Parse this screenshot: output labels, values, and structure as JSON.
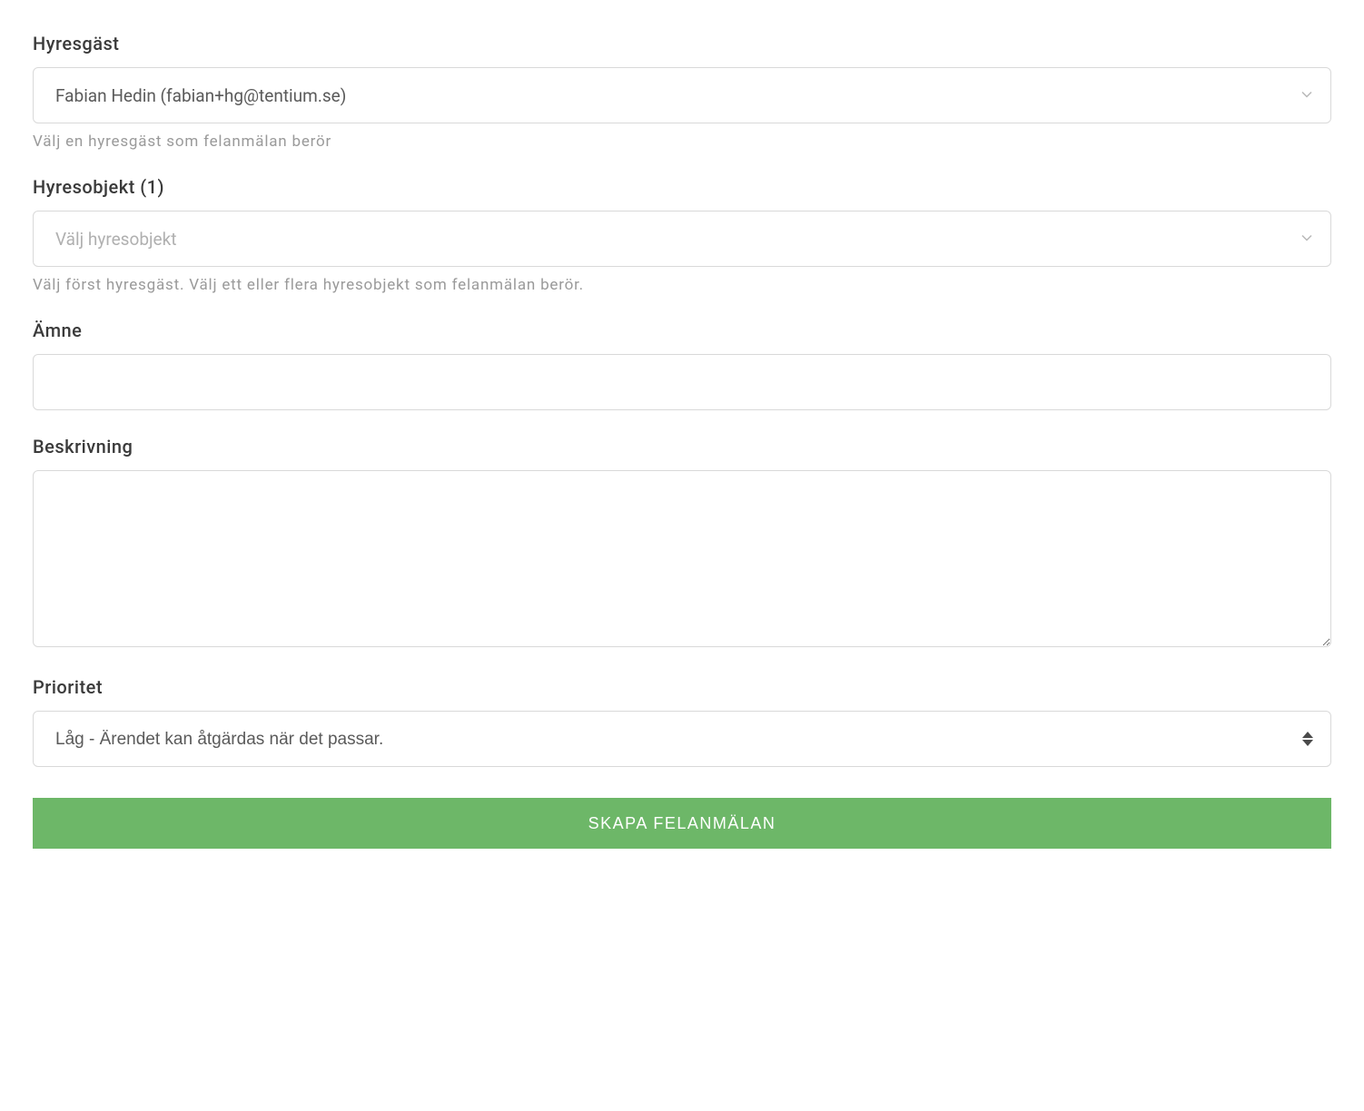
{
  "tenant": {
    "label": "Hyresgäst",
    "value": "Fabian Hedin (fabian+hg@tentium.se)",
    "help": "Välj en hyresgäst som felanmälan berör"
  },
  "property": {
    "label": "Hyresobjekt (1)",
    "placeholder": "Välj hyresobjekt",
    "help": "Välj först hyresgäst. Välj ett eller flera hyresobjekt som felanmälan berör."
  },
  "subject": {
    "label": "Ämne",
    "value": ""
  },
  "description": {
    "label": "Beskrivning",
    "value": ""
  },
  "priority": {
    "label": "Prioritet",
    "selected": "Låg - Ärendet kan åtgärdas när det passar."
  },
  "submit": {
    "label": "SKAPA FELANMÄLAN"
  }
}
